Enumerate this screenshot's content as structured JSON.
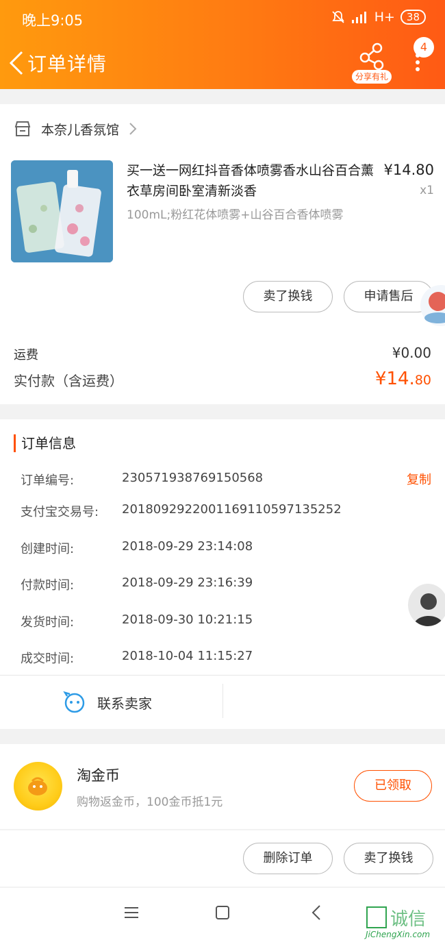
{
  "status_bar": {
    "time": "晚上9:05",
    "network": "H+",
    "battery": "38"
  },
  "navbar": {
    "title": "订单详情",
    "share_label": "分享有礼",
    "more_badge": "4"
  },
  "order": {
    "shop_name": "本奈儿香氛馆",
    "product_title": "买一送一网红抖音香体喷雾香水山谷百合薰衣草房间卧室清新淡香",
    "product_sku": "100mL;粉红花体喷雾+山谷百合香体喷雾",
    "price": "¥14.80",
    "quantity": "x1",
    "sell_button": "卖了换钱",
    "aftersale_button": "申请售后",
    "shipping_label": "运费",
    "shipping_value": "¥0.00",
    "paid_label": "实付款（含运费）",
    "paid_integer": "¥14.",
    "paid_cents": "80"
  },
  "order_info": {
    "title": "订单信息",
    "copy_label": "复制",
    "rows": [
      {
        "label": "订单编号:",
        "value": "230571938769150568"
      },
      {
        "label": "支付宝交易号:",
        "value": "2018092922001169110597135252"
      },
      {
        "label": "创建时间:",
        "value": "2018-09-29 23:14:08"
      },
      {
        "label": "付款时间:",
        "value": "2018-09-29 23:16:39"
      },
      {
        "label": "发货时间:",
        "value": "2018-09-30 10:21:15"
      },
      {
        "label": "成交时间:",
        "value": "2018-10-04 11:15:27"
      }
    ],
    "contact_seller": "联系卖家"
  },
  "coin": {
    "title": "淘金币",
    "subtitle": "购物返金币，100金币抵1元",
    "button": "已领取"
  },
  "actions": {
    "delete_order": "删除订单",
    "sell": "卖了换钱"
  },
  "watermark": {
    "brand": "集诚信",
    "url": "JiChengXin.com"
  },
  "colors": {
    "accent": "#ff5000",
    "header_start": "#ff9a0e",
    "header_end": "#ff5a14"
  }
}
